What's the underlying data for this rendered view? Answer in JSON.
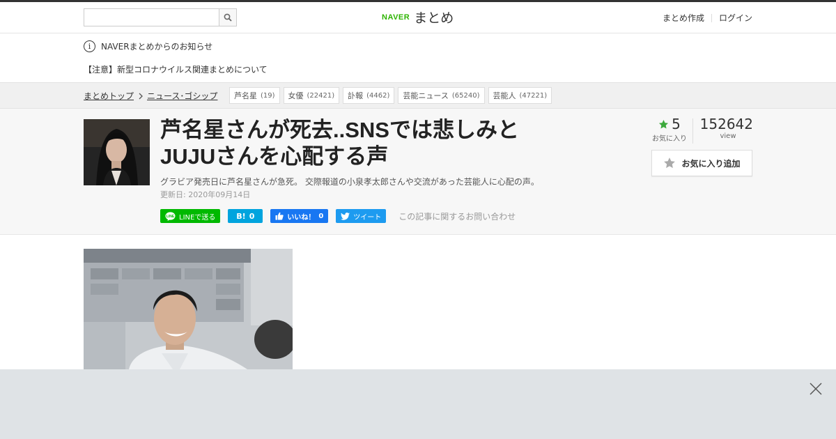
{
  "header": {
    "search": {
      "value": "",
      "placeholder": ""
    },
    "logo": {
      "brand": "NAVER",
      "name": "まとめ"
    },
    "links": {
      "create": "まとめ作成",
      "login": "ログイン"
    }
  },
  "notice": {
    "heading": "NAVERまとめからのお知らせ",
    "link": "【注意】新型コロナウイルス関連まとめについて"
  },
  "breadcrumb": {
    "items": [
      "まとめトップ",
      "ニュース･ゴシップ"
    ]
  },
  "tags": [
    {
      "label": "芦名星",
      "count": "(19)"
    },
    {
      "label": "女優",
      "count": "(22421)"
    },
    {
      "label": "訃報",
      "count": "(4462)"
    },
    {
      "label": "芸能ニュース",
      "count": "(65240)"
    },
    {
      "label": "芸能人",
      "count": "(47221)"
    }
  ],
  "article": {
    "title_line1": "芦名星さんが死去..SNSでは悲しみと",
    "title_line2": "JUJUさんを心配する声",
    "description": "グラビア発売日に芦名星さんが急死。 交際報道の小泉孝太郎さんや交流があった芸能人に心配の声。",
    "updated": "更新日: 2020年09月14日"
  },
  "share": {
    "line": "LINEで送る",
    "hatena_mark": "B!",
    "hatena_count": "0",
    "fb": "いいね！",
    "fb_count": "0",
    "tweet": "ツイート",
    "contact": "この記事に関するお問い合わせ"
  },
  "stats": {
    "favorites": "5",
    "favorites_label": "お気に入り",
    "views": "152642",
    "views_label": "view"
  },
  "fav_button": "お気に入り追加",
  "colors": {
    "naver_green": "#2db400",
    "line_green": "#00b900",
    "hatena_blue": "#00a4de",
    "facebook_blue": "#1877f2",
    "twitter_blue": "#1d9bf0",
    "star_green": "#3daa3d"
  }
}
